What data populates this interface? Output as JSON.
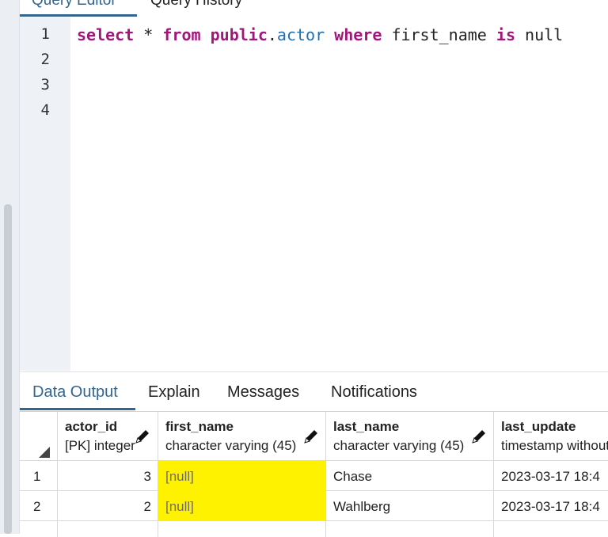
{
  "editor_tabs": [
    "Query Editor",
    "Query History"
  ],
  "line_numbers": [
    "1",
    "2",
    "3",
    "4"
  ],
  "query": {
    "kw_select": "select",
    "star": "*",
    "kw_from": "from",
    "schema": "public",
    "dot": ".",
    "table": "actor",
    "kw_where": "where",
    "column": "first_name",
    "kw_is": "is",
    "kw_null": "null"
  },
  "results_tabs": [
    "Data Output",
    "Explain",
    "Messages",
    "Notifications"
  ],
  "columns": [
    {
      "name": "actor_id",
      "type": "[PK] integer"
    },
    {
      "name": "first_name",
      "type": "character varying (45)"
    },
    {
      "name": "last_name",
      "type": "character varying (45)"
    },
    {
      "name": "last_update",
      "type": "timestamp without time zone"
    }
  ],
  "rows": [
    {
      "num": "1",
      "actor_id": "3",
      "first_name": "[null]",
      "last_name": "Chase",
      "last_update": "2023-03-17 18:4"
    },
    {
      "num": "2",
      "actor_id": "2",
      "first_name": "[null]",
      "last_name": "Wahlberg",
      "last_update": "2023-03-17 18:4"
    }
  ],
  "colors": {
    "accent": "#326690",
    "keyword": "#a0167b",
    "null_highlight": "#fff200"
  }
}
